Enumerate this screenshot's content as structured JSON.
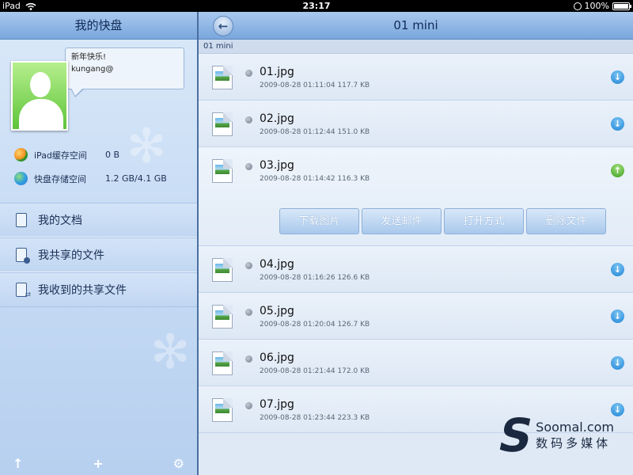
{
  "status_bar": {
    "device": "iPad",
    "time": "23:17",
    "battery": "100%",
    "battery_level": 1.0
  },
  "left_pane": {
    "title": "我的快盘",
    "bubble_line1": "新年快乐!",
    "bubble_line2": "kungang@",
    "storage": [
      {
        "label": "iPad缓存空间",
        "value": "0 B"
      },
      {
        "label": "快盘存储空间",
        "value": "1.2 GB/4.1 GB"
      }
    ],
    "nav": [
      {
        "label": "我的文档",
        "icon": "document-icon"
      },
      {
        "label": "我共享的文件",
        "icon": "shared-document-icon"
      },
      {
        "label": "我收到的共享文件",
        "icon": "received-document-icon"
      }
    ],
    "toolbar": {
      "upload": "↑",
      "add": "+",
      "settings": "⚙"
    }
  },
  "right_pane": {
    "title": "01 mini",
    "back": "←",
    "path": "01 mini",
    "files": [
      {
        "name": "01.jpg",
        "meta": "2009-08-28 01:11:04   117.7 KB",
        "arrow": "↓"
      },
      {
        "name": "02.jpg",
        "meta": "2009-08-28 01:12:44   151.0 KB",
        "arrow": "↓"
      },
      {
        "name": "03.jpg",
        "meta": "2009-08-28 01:14:42   116.3 KB",
        "arrow": "↑"
      },
      {
        "name": "04.jpg",
        "meta": "2009-08-28 01:16:26   126.6 KB",
        "arrow": "↓"
      },
      {
        "name": "05.jpg",
        "meta": "2009-08-28 01:20:04   126.7 KB",
        "arrow": "↓"
      },
      {
        "name": "06.jpg",
        "meta": "2009-08-28 01:21:44   172.0 KB",
        "arrow": "↓"
      },
      {
        "name": "07.jpg",
        "meta": "2009-08-28 01:23:44   223.3 KB",
        "arrow": "↓"
      }
    ],
    "actions": [
      "下载图片",
      "发送邮件",
      "打开方式",
      "删除文件"
    ]
  },
  "watermark": {
    "line1": "Soomal.com",
    "line2": "数码多媒体"
  },
  "colors": {
    "header": "#7aa7dd",
    "download_arrow": "#1f85d6",
    "upload_arrow": "#3a9e1f"
  }
}
